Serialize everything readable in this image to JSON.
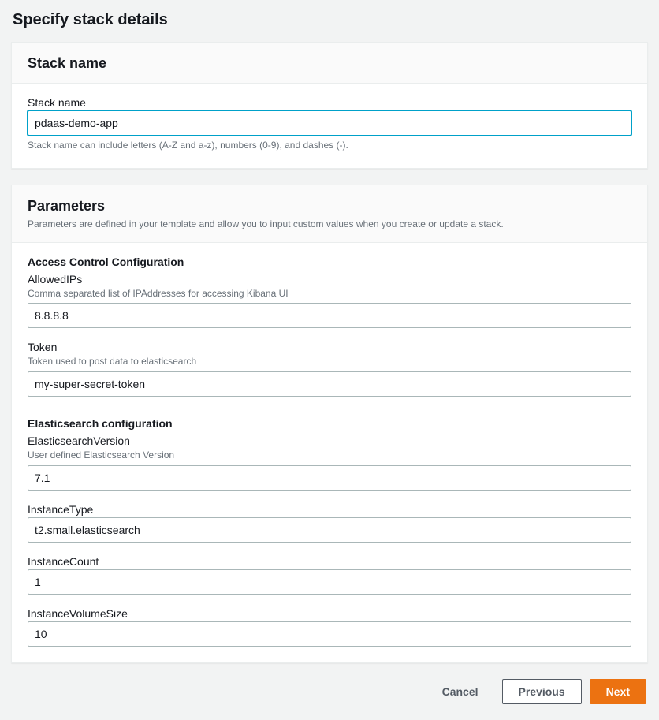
{
  "page": {
    "title": "Specify stack details"
  },
  "stack_name_panel": {
    "header": "Stack name",
    "field_label": "Stack name",
    "value": "pdaas-demo-app",
    "hint": "Stack name can include letters (A-Z and a-z), numbers (0-9), and dashes (-)."
  },
  "parameters_panel": {
    "header": "Parameters",
    "description": "Parameters are defined in your template and allow you to input custom values when you create or update a stack.",
    "groups": [
      {
        "title": "Access Control Configuration",
        "fields": [
          {
            "label": "AllowedIPs",
            "hint": "Comma separated list of IPAddresses for accessing Kibana UI",
            "value": "8.8.8.8"
          },
          {
            "label": "Token",
            "hint": "Token used to post data to elasticsearch",
            "value": "my-super-secret-token"
          }
        ]
      },
      {
        "title": "Elasticsearch configuration",
        "fields": [
          {
            "label": "ElasticsearchVersion",
            "hint": "User defined Elasticsearch Version",
            "value": "7.1"
          },
          {
            "label": "InstanceType",
            "hint": "",
            "value": "t2.small.elasticsearch"
          },
          {
            "label": "InstanceCount",
            "hint": "",
            "value": "1"
          },
          {
            "label": "InstanceVolumeSize",
            "hint": "",
            "value": "10"
          }
        ]
      }
    ]
  },
  "footer": {
    "cancel": "Cancel",
    "previous": "Previous",
    "next": "Next"
  }
}
